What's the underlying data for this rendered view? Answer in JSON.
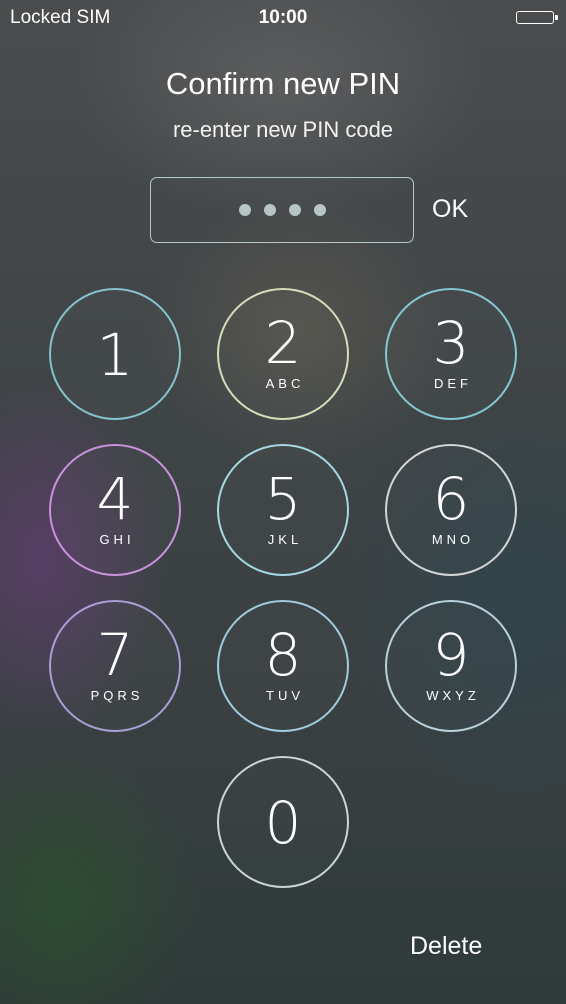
{
  "status_bar": {
    "carrier": "Locked SIM",
    "time": "10:00",
    "battery_icon": "battery-full-icon"
  },
  "header": {
    "title": "Confirm new PIN",
    "subtitle": "re-enter new PIN code"
  },
  "pin_entry": {
    "entered_digits": 4,
    "ok_label": "OK"
  },
  "keypad": {
    "keys": [
      {
        "digit": "1",
        "letters": ""
      },
      {
        "digit": "2",
        "letters": "ABC"
      },
      {
        "digit": "3",
        "letters": "DEF"
      },
      {
        "digit": "4",
        "letters": "GHI"
      },
      {
        "digit": "5",
        "letters": "JKL"
      },
      {
        "digit": "6",
        "letters": "MNO"
      },
      {
        "digit": "7",
        "letters": "PQRS"
      },
      {
        "digit": "8",
        "letters": "TUV"
      },
      {
        "digit": "9",
        "letters": "WXYZ"
      },
      {
        "digit": "0",
        "letters": ""
      }
    ]
  },
  "footer": {
    "delete_label": "Delete"
  }
}
